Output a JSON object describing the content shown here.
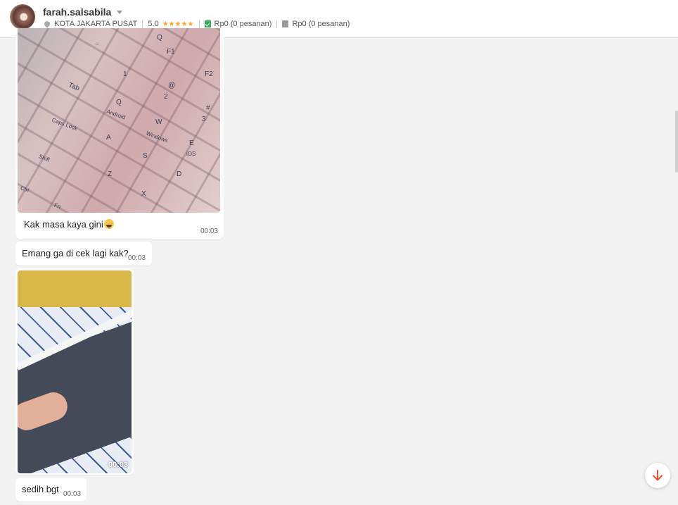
{
  "header": {
    "username": "farah.salsabila",
    "location": "KOTA JAKARTA PUSAT",
    "rating": "5.0",
    "stars": "★★★★★",
    "completed_orders": "Rp0 (0 pesanan)",
    "cancelled_orders": "Rp0 (0 pesanan)"
  },
  "messages": [
    {
      "type": "image",
      "caption": "Kak masa kaya gini",
      "time": "00:03"
    },
    {
      "type": "text",
      "text": "Emang ga di cek lagi kak?",
      "time": "00:03"
    },
    {
      "type": "video",
      "duration": "00:03"
    },
    {
      "type": "text",
      "text": "sedih bgt",
      "time": "00:03"
    }
  ],
  "keyboard_keys": [
    "~",
    "Q",
    "F1",
    "Tab",
    "1",
    "@",
    "2",
    "F2",
    "Q",
    "Android",
    "W",
    "#",
    "3",
    "Caps Lock",
    "Windows",
    "E",
    "iOS",
    "A",
    "S",
    "Shift",
    "Z",
    "D",
    "Ctrl",
    "X",
    "Fn"
  ],
  "colors": {
    "accent": "#ee4d2d",
    "star": "#f5a623",
    "green": "#2db04f"
  },
  "icons": {
    "scroll_down": "arrow-down-icon",
    "location": "location-pin-icon"
  }
}
